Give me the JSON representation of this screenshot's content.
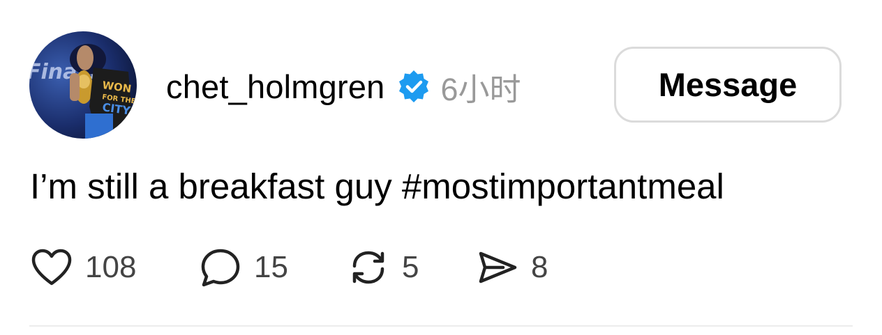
{
  "post": {
    "avatar_icon": "player-holding-trophy-avatar",
    "avatar_shirt_text": [
      "WON",
      "FOR THE",
      "CITY"
    ],
    "avatar_bg_text": "Finals",
    "username": "chet_holmgren",
    "verified_icon": "verified-badge-icon",
    "verified_color": "#1d9bf0",
    "timestamp": "6小时",
    "message_button": "Message",
    "text": "I’m still a breakfast guy #mostimportantmeal",
    "actions": {
      "like": {
        "icon": "heart-icon",
        "count": "108"
      },
      "comment": {
        "icon": "comment-bubble-icon",
        "count": "15"
      },
      "repost": {
        "icon": "repost-icon",
        "count": "5"
      },
      "share": {
        "icon": "send-icon",
        "count": "8"
      }
    }
  }
}
